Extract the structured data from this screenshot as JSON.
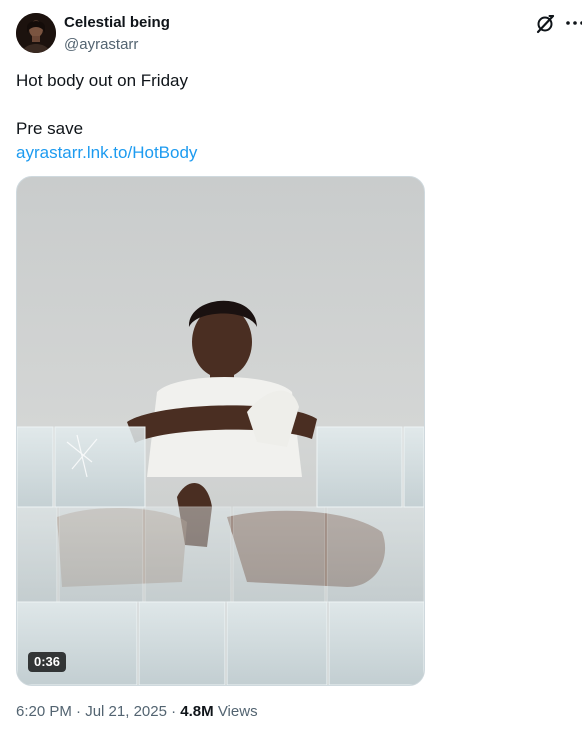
{
  "user": {
    "display_name": "Celestial being",
    "handle": "@ayrastarr",
    "avatar_icon": "avatar-photo"
  },
  "header_icons": [
    "grok-icon",
    "more-options-icon"
  ],
  "tweet": {
    "line1": "Hot body out on Friday",
    "line2": "Pre save",
    "link": "ayrastarr.lnk.to/HotBody"
  },
  "media": {
    "type": "video",
    "duration": "0:36"
  },
  "meta": {
    "time": "6:20 PM",
    "separator": "·",
    "date": "Jul 21, 2025",
    "views_count": "4.8M",
    "views_label": "Views"
  },
  "colors": {
    "link": "#1d9bf0",
    "secondary_text": "#536471",
    "primary_text": "#0f1419",
    "border": "#cfd9de"
  }
}
